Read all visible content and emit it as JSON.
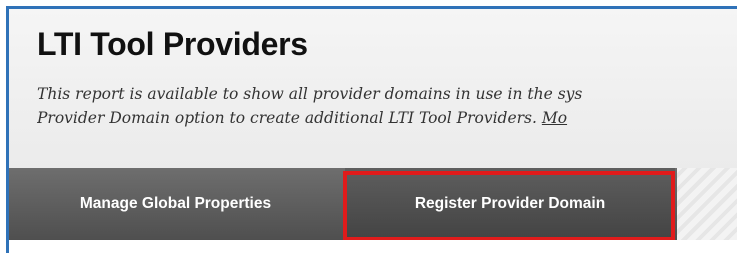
{
  "page": {
    "title": "LTI Tool Providers",
    "description_line1": "This report is available to show all provider domains in use in the sys",
    "description_line2_prefix": "Provider Domain option to create additional LTI Tool Providers. ",
    "description_more_link": "Mo"
  },
  "action_bar": {
    "manage_global_properties_label": "Manage Global Properties",
    "register_provider_domain_label": "Register Provider Domain"
  },
  "colors": {
    "frame_border": "#2f72b8",
    "highlight": "#e01b1b",
    "action_bar": "#5a5a5a"
  }
}
